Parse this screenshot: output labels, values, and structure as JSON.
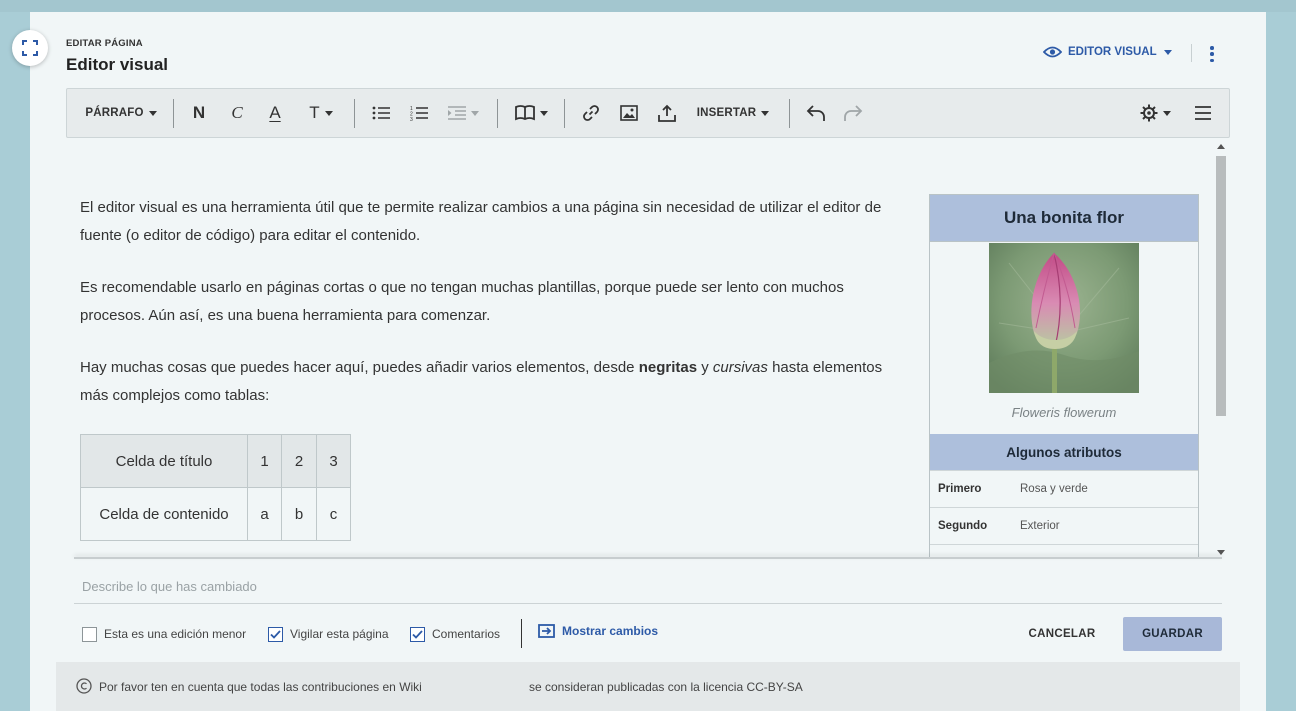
{
  "header": {
    "eyebrow": "EDITAR PÁGINA",
    "title": "Editor visual",
    "mode_label": "EDITOR VISUAL"
  },
  "toolbar": {
    "paragraph_label": "PÁRRAFO",
    "bold_label": "N",
    "italic_label": "C",
    "underline_label": "A",
    "text_label": "T",
    "insert_label": "INSERTAR"
  },
  "content": {
    "p1": "El editor visual es una herramienta útil que te permite realizar cambios a una página sin necesidad de utilizar el editor de fuente (o editor de código) para editar el contenido.",
    "p2": "Es recomendable usarlo en páginas cortas o que no tengan muchas plantillas, porque puede ser lento con muchos procesos. Aún así, es una buena herramienta para comenzar.",
    "p3_before": "Hay muchas cosas que puedes hacer aquí, puedes añadir varios elementos, desde ",
    "p3_bold": "negritas",
    "p3_mid": " y ",
    "p3_italic": "cursivas",
    "p3_after": " hasta elementos más complejos como tablas:",
    "table": {
      "header_row": [
        "Celda de título",
        "1",
        "2",
        "3"
      ],
      "content_row": [
        "Celda de contenido",
        "a",
        "b",
        "c"
      ]
    }
  },
  "infobox": {
    "title": "Una bonita flor",
    "caption": "Floweris flowerum",
    "subheading": "Algunos atributos",
    "rows": [
      {
        "key": "Primero",
        "value": "Rosa y verde"
      },
      {
        "key": "Segundo",
        "value": "Exterior"
      }
    ]
  },
  "save_panel": {
    "summary_placeholder": "Describe lo que has cambiado",
    "minor_edit_label": "Esta es una edición menor",
    "minor_edit_checked": false,
    "watch_label": "Vigilar esta página",
    "watch_checked": true,
    "comments_label": "Comentarios",
    "comments_checked": true,
    "show_changes_label": "Mostrar cambios",
    "cancel_label": "CANCELAR",
    "save_label": "GUARDAR"
  },
  "footer": {
    "text_part1": "Por favor ten en cuenta que todas las contribuciones en Wiki",
    "text_part2": "se consideran publicadas con la licencia CC-BY-SA"
  },
  "colors": {
    "accent": "#2d5aa7",
    "infobox_header": "#adbfdc",
    "save_button": "#a8b8d8",
    "page_bg": "#f1f6f7",
    "frame_bg": "#a9cdd6"
  }
}
